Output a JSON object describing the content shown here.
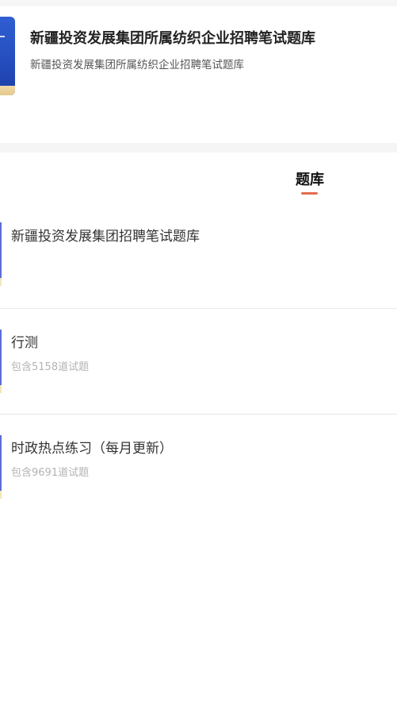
{
  "header": {
    "title": "新疆投资发展集团所属纺织企业招聘笔试题库",
    "subtitle": "新疆投资发展集团所属纺织企业招聘笔试题库"
  },
  "tabs": [
    {
      "label": "题库",
      "active": true
    }
  ],
  "accent_color": "#e56b4f",
  "marker_color": "#5b6fd6",
  "bank_list": [
    {
      "title": "新疆投资发展集团招聘笔试题库",
      "subtitle": ""
    },
    {
      "title": "行测",
      "subtitle": "包含5158道试题"
    },
    {
      "title": "时政热点练习（每月更新）",
      "subtitle": "包含9691道试题"
    }
  ]
}
